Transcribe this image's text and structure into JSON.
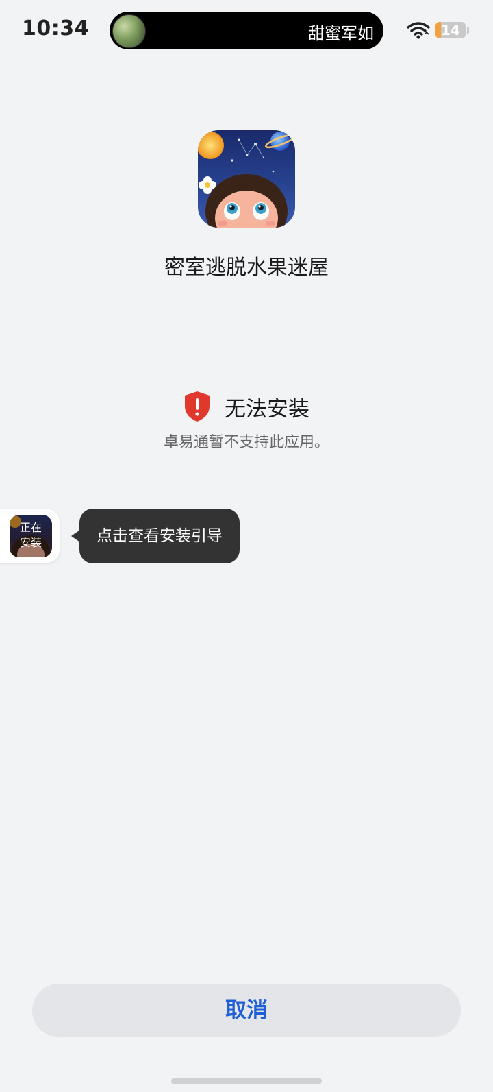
{
  "status_bar": {
    "time": "10:34",
    "island_text": "甜蜜军如",
    "battery_level": "14",
    "battery_fraction": 0.14,
    "icons": [
      "wifi-icon",
      "battery-icon"
    ]
  },
  "app": {
    "name": "密室逃脱水果迷屋",
    "icon": "app-icon"
  },
  "error": {
    "icon": "shield-alert-icon",
    "title": "无法安装",
    "description": "卓易通暂不支持此应用。"
  },
  "floating_widget": {
    "status_label": "正在安装",
    "tooltip": "点击查看安装引导"
  },
  "actions": {
    "cancel_label": "取消"
  },
  "colors": {
    "background": "#f2f3f5",
    "accent": "#1f5fd6",
    "error_red": "#e0382c",
    "tooltip_bg": "#333333",
    "battery_orange": "#f2a23c"
  }
}
